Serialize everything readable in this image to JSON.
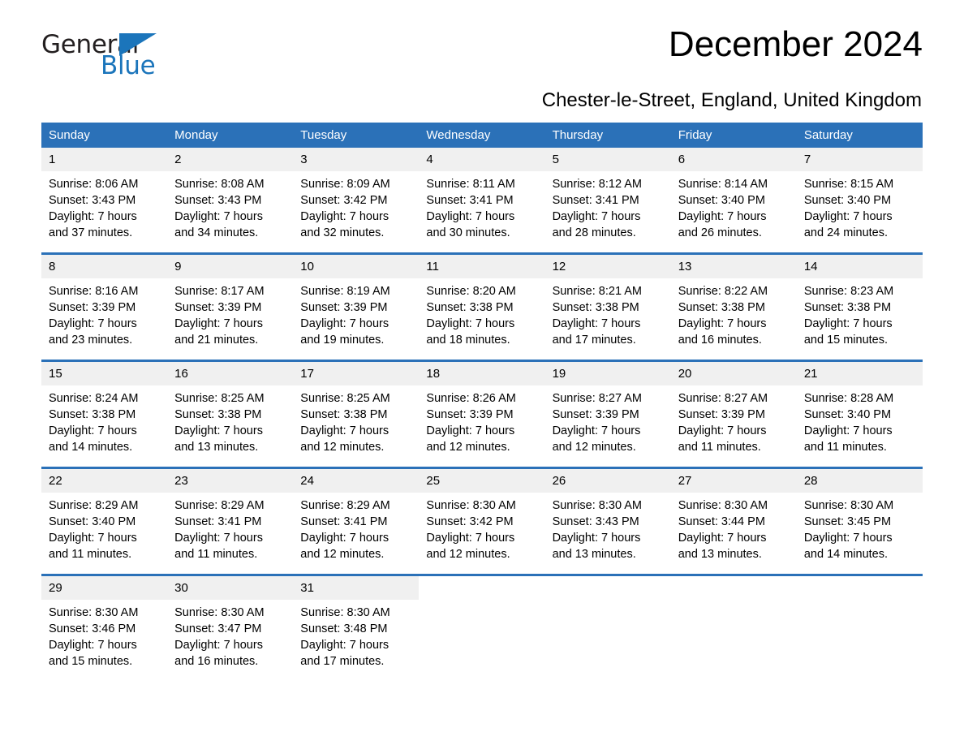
{
  "brand": {
    "name_part1": "General",
    "name_part2": "Blue",
    "triangle_icon": "triangle-icon",
    "accent_color": "#1b75bb"
  },
  "header": {
    "title": "December 2024",
    "location": "Chester-le-Street, England, United Kingdom",
    "header_bar_color": "#2b71b8",
    "daynum_band_color": "#f0f0f0"
  },
  "weekday_headers": [
    "Sunday",
    "Monday",
    "Tuesday",
    "Wednesday",
    "Thursday",
    "Friday",
    "Saturday"
  ],
  "weeks": [
    [
      {
        "day": "1",
        "sunrise": "Sunrise: 8:06 AM",
        "sunset": "Sunset: 3:43 PM",
        "daylight_1": "Daylight: 7 hours",
        "daylight_2": "and 37 minutes."
      },
      {
        "day": "2",
        "sunrise": "Sunrise: 8:08 AM",
        "sunset": "Sunset: 3:43 PM",
        "daylight_1": "Daylight: 7 hours",
        "daylight_2": "and 34 minutes."
      },
      {
        "day": "3",
        "sunrise": "Sunrise: 8:09 AM",
        "sunset": "Sunset: 3:42 PM",
        "daylight_1": "Daylight: 7 hours",
        "daylight_2": "and 32 minutes."
      },
      {
        "day": "4",
        "sunrise": "Sunrise: 8:11 AM",
        "sunset": "Sunset: 3:41 PM",
        "daylight_1": "Daylight: 7 hours",
        "daylight_2": "and 30 minutes."
      },
      {
        "day": "5",
        "sunrise": "Sunrise: 8:12 AM",
        "sunset": "Sunset: 3:41 PM",
        "daylight_1": "Daylight: 7 hours",
        "daylight_2": "and 28 minutes."
      },
      {
        "day": "6",
        "sunrise": "Sunrise: 8:14 AM",
        "sunset": "Sunset: 3:40 PM",
        "daylight_1": "Daylight: 7 hours",
        "daylight_2": "and 26 minutes."
      },
      {
        "day": "7",
        "sunrise": "Sunrise: 8:15 AM",
        "sunset": "Sunset: 3:40 PM",
        "daylight_1": "Daylight: 7 hours",
        "daylight_2": "and 24 minutes."
      }
    ],
    [
      {
        "day": "8",
        "sunrise": "Sunrise: 8:16 AM",
        "sunset": "Sunset: 3:39 PM",
        "daylight_1": "Daylight: 7 hours",
        "daylight_2": "and 23 minutes."
      },
      {
        "day": "9",
        "sunrise": "Sunrise: 8:17 AM",
        "sunset": "Sunset: 3:39 PM",
        "daylight_1": "Daylight: 7 hours",
        "daylight_2": "and 21 minutes."
      },
      {
        "day": "10",
        "sunrise": "Sunrise: 8:19 AM",
        "sunset": "Sunset: 3:39 PM",
        "daylight_1": "Daylight: 7 hours",
        "daylight_2": "and 19 minutes."
      },
      {
        "day": "11",
        "sunrise": "Sunrise: 8:20 AM",
        "sunset": "Sunset: 3:38 PM",
        "daylight_1": "Daylight: 7 hours",
        "daylight_2": "and 18 minutes."
      },
      {
        "day": "12",
        "sunrise": "Sunrise: 8:21 AM",
        "sunset": "Sunset: 3:38 PM",
        "daylight_1": "Daylight: 7 hours",
        "daylight_2": "and 17 minutes."
      },
      {
        "day": "13",
        "sunrise": "Sunrise: 8:22 AM",
        "sunset": "Sunset: 3:38 PM",
        "daylight_1": "Daylight: 7 hours",
        "daylight_2": "and 16 minutes."
      },
      {
        "day": "14",
        "sunrise": "Sunrise: 8:23 AM",
        "sunset": "Sunset: 3:38 PM",
        "daylight_1": "Daylight: 7 hours",
        "daylight_2": "and 15 minutes."
      }
    ],
    [
      {
        "day": "15",
        "sunrise": "Sunrise: 8:24 AM",
        "sunset": "Sunset: 3:38 PM",
        "daylight_1": "Daylight: 7 hours",
        "daylight_2": "and 14 minutes."
      },
      {
        "day": "16",
        "sunrise": "Sunrise: 8:25 AM",
        "sunset": "Sunset: 3:38 PM",
        "daylight_1": "Daylight: 7 hours",
        "daylight_2": "and 13 minutes."
      },
      {
        "day": "17",
        "sunrise": "Sunrise: 8:25 AM",
        "sunset": "Sunset: 3:38 PM",
        "daylight_1": "Daylight: 7 hours",
        "daylight_2": "and 12 minutes."
      },
      {
        "day": "18",
        "sunrise": "Sunrise: 8:26 AM",
        "sunset": "Sunset: 3:39 PM",
        "daylight_1": "Daylight: 7 hours",
        "daylight_2": "and 12 minutes."
      },
      {
        "day": "19",
        "sunrise": "Sunrise: 8:27 AM",
        "sunset": "Sunset: 3:39 PM",
        "daylight_1": "Daylight: 7 hours",
        "daylight_2": "and 12 minutes."
      },
      {
        "day": "20",
        "sunrise": "Sunrise: 8:27 AM",
        "sunset": "Sunset: 3:39 PM",
        "daylight_1": "Daylight: 7 hours",
        "daylight_2": "and 11 minutes."
      },
      {
        "day": "21",
        "sunrise": "Sunrise: 8:28 AM",
        "sunset": "Sunset: 3:40 PM",
        "daylight_1": "Daylight: 7 hours",
        "daylight_2": "and 11 minutes."
      }
    ],
    [
      {
        "day": "22",
        "sunrise": "Sunrise: 8:29 AM",
        "sunset": "Sunset: 3:40 PM",
        "daylight_1": "Daylight: 7 hours",
        "daylight_2": "and 11 minutes."
      },
      {
        "day": "23",
        "sunrise": "Sunrise: 8:29 AM",
        "sunset": "Sunset: 3:41 PM",
        "daylight_1": "Daylight: 7 hours",
        "daylight_2": "and 11 minutes."
      },
      {
        "day": "24",
        "sunrise": "Sunrise: 8:29 AM",
        "sunset": "Sunset: 3:41 PM",
        "daylight_1": "Daylight: 7 hours",
        "daylight_2": "and 12 minutes."
      },
      {
        "day": "25",
        "sunrise": "Sunrise: 8:30 AM",
        "sunset": "Sunset: 3:42 PM",
        "daylight_1": "Daylight: 7 hours",
        "daylight_2": "and 12 minutes."
      },
      {
        "day": "26",
        "sunrise": "Sunrise: 8:30 AM",
        "sunset": "Sunset: 3:43 PM",
        "daylight_1": "Daylight: 7 hours",
        "daylight_2": "and 13 minutes."
      },
      {
        "day": "27",
        "sunrise": "Sunrise: 8:30 AM",
        "sunset": "Sunset: 3:44 PM",
        "daylight_1": "Daylight: 7 hours",
        "daylight_2": "and 13 minutes."
      },
      {
        "day": "28",
        "sunrise": "Sunrise: 8:30 AM",
        "sunset": "Sunset: 3:45 PM",
        "daylight_1": "Daylight: 7 hours",
        "daylight_2": "and 14 minutes."
      }
    ],
    [
      {
        "day": "29",
        "sunrise": "Sunrise: 8:30 AM",
        "sunset": "Sunset: 3:46 PM",
        "daylight_1": "Daylight: 7 hours",
        "daylight_2": "and 15 minutes."
      },
      {
        "day": "30",
        "sunrise": "Sunrise: 8:30 AM",
        "sunset": "Sunset: 3:47 PM",
        "daylight_1": "Daylight: 7 hours",
        "daylight_2": "and 16 minutes."
      },
      {
        "day": "31",
        "sunrise": "Sunrise: 8:30 AM",
        "sunset": "Sunset: 3:48 PM",
        "daylight_1": "Daylight: 7 hours",
        "daylight_2": "and 17 minutes."
      },
      {
        "day": "",
        "sunrise": "",
        "sunset": "",
        "daylight_1": "",
        "daylight_2": ""
      },
      {
        "day": "",
        "sunrise": "",
        "sunset": "",
        "daylight_1": "",
        "daylight_2": ""
      },
      {
        "day": "",
        "sunrise": "",
        "sunset": "",
        "daylight_1": "",
        "daylight_2": ""
      },
      {
        "day": "",
        "sunrise": "",
        "sunset": "",
        "daylight_1": "",
        "daylight_2": ""
      }
    ]
  ]
}
